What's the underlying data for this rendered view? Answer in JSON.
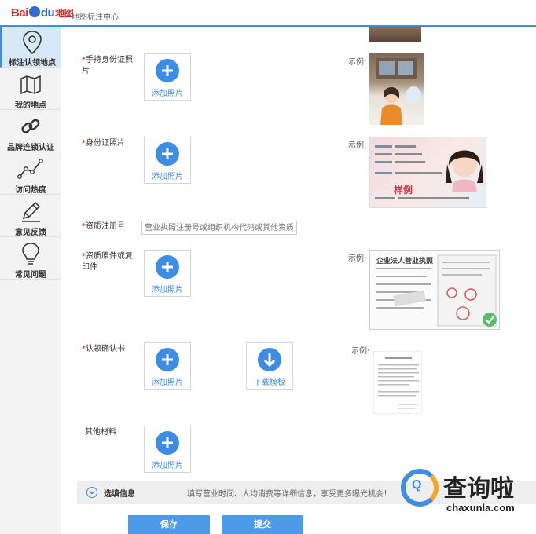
{
  "header": {
    "logo_text": "Bai",
    "logo_du": "du",
    "logo_map": "地图",
    "title": "地图标注中心"
  },
  "sidebar": {
    "items": [
      {
        "label": "标注认领地点",
        "icon": "location-pin-icon",
        "active": true
      },
      {
        "label": "我的地点",
        "icon": "map-icon"
      },
      {
        "label": "品牌连锁认证",
        "icon": "chain-link-icon"
      },
      {
        "label": "访问热度",
        "icon": "line-chart-icon"
      },
      {
        "label": "意见反馈",
        "icon": "pencil-icon"
      },
      {
        "label": "常见问题",
        "icon": "lightbulb-icon"
      }
    ]
  },
  "form": {
    "required_mark": "*",
    "handheld_id": {
      "label": "手持身份证照片",
      "upload": "添加照片",
      "sample": "示例:"
    },
    "id_card": {
      "label": "身份证照片",
      "upload": "添加照片",
      "sample": "示例:"
    },
    "reg_no": {
      "label": "资质注册号",
      "placeholder": "营业执照注册号或组织机构代码或其他资质"
    },
    "qualification": {
      "label": "资质原件或复印件",
      "upload": "添加照片",
      "sample": "示例:"
    },
    "claim_letter": {
      "label": "认领确认书",
      "upload": "添加照片",
      "download": "下载模板",
      "sample": "示例:"
    },
    "other": {
      "label": "其他材料",
      "upload": "添加照片"
    }
  },
  "samples": {
    "id_card_stamp": "样例",
    "license_title": "企业法人营业执照"
  },
  "optional": {
    "title": "选填信息",
    "desc": "填写营业时间、人均消费等详细信息，享受更多曝光机会！"
  },
  "buttons": {
    "save": "保存",
    "submit": "提交"
  },
  "watermark": {
    "big": "查询啦",
    "small": "chaxunla.com"
  },
  "colors": {
    "accent": "#3c8ee0",
    "required": "#e02020"
  }
}
